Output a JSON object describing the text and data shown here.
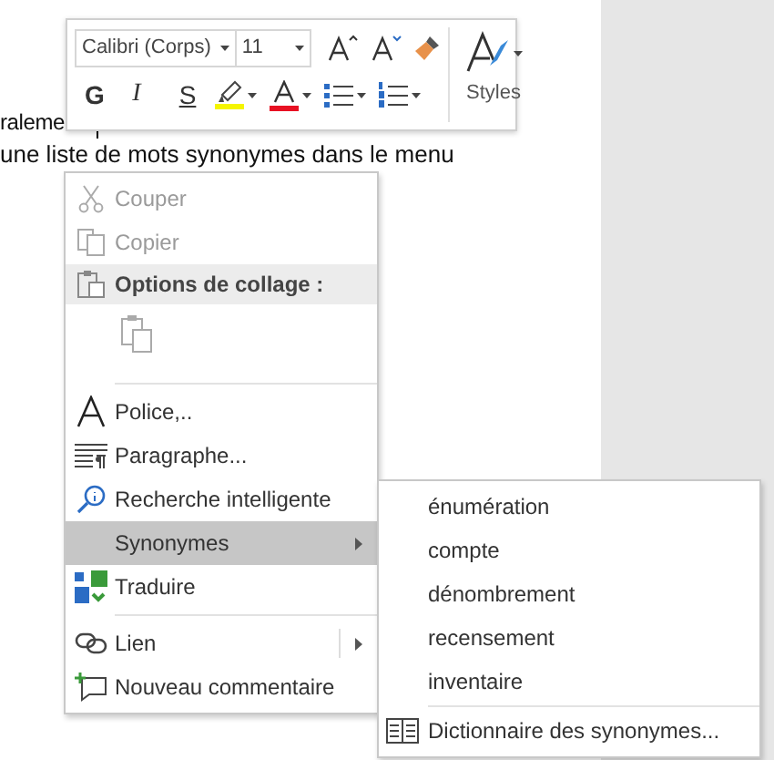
{
  "document": {
    "lines": [
      "raleme",
      "une liste de mots synonymes dans le menu"
    ]
  },
  "mini_toolbar": {
    "font_name": "Calibri (Corps)",
    "font_size": "11",
    "bold": "G",
    "italic": "I",
    "underline": "S",
    "styles": "Styles"
  },
  "context_menu": {
    "items": [
      {
        "kind": "item",
        "label": "Couper",
        "disabled": true,
        "selected": false,
        "submenu": false
      },
      {
        "kind": "item",
        "label": "Copier",
        "disabled": true,
        "selected": false,
        "submenu": false
      },
      {
        "kind": "header",
        "label": "Options de collage :"
      },
      {
        "kind": "paste"
      },
      {
        "kind": "separator"
      },
      {
        "kind": "item",
        "label": "Police,..",
        "disabled": false,
        "selected": false,
        "submenu": false
      },
      {
        "kind": "item",
        "label": "Paragraphe...",
        "disabled": false,
        "selected": false,
        "submenu": false
      },
      {
        "kind": "item",
        "label": "Recherche intelligente",
        "disabled": false,
        "selected": false,
        "submenu": false
      },
      {
        "kind": "item",
        "label": "Synonymes",
        "disabled": false,
        "selected": true,
        "submenu": true
      },
      {
        "kind": "item",
        "label": "Traduire",
        "disabled": false,
        "selected": false,
        "submenu": false
      },
      {
        "kind": "separator"
      },
      {
        "kind": "item",
        "label": "Lien",
        "disabled": false,
        "selected": false,
        "submenu": true
      },
      {
        "kind": "item",
        "label": "Nouveau commentaire",
        "disabled": false,
        "selected": false,
        "submenu": false
      }
    ]
  },
  "submenu": {
    "items": [
      "énumération",
      "compte",
      "dénombrement",
      "recensement",
      "inventaire"
    ],
    "footer": "Dictionnaire des synonymes..."
  }
}
